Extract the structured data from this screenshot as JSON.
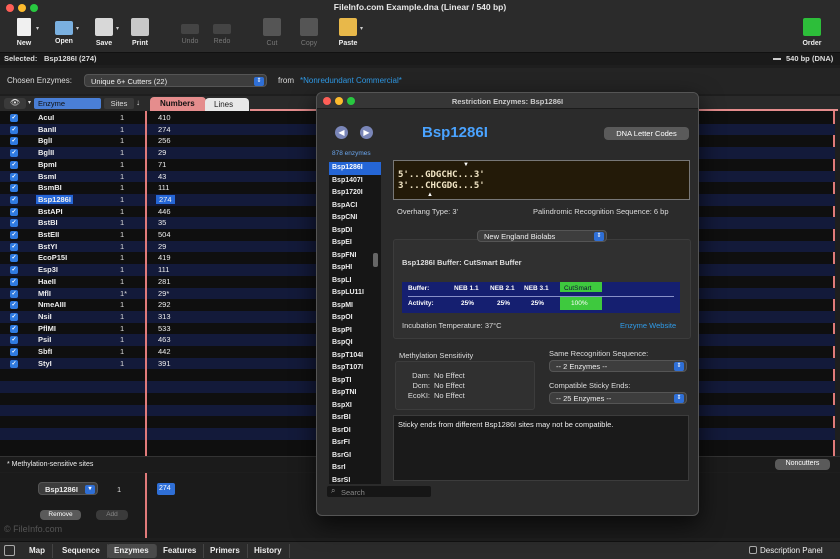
{
  "window": {
    "title": "FileInfo.com Example.dna  (Linear / 540 bp)"
  },
  "toolbar": {
    "new": "New",
    "open": "Open",
    "save": "Save",
    "print": "Print",
    "undo": "Undo",
    "redo": "Redo",
    "cut": "Cut",
    "copy": "Copy",
    "paste": "Paste",
    "order": "Order"
  },
  "selection": {
    "label": "Selected:",
    "value": "Bsp1286I (274)",
    "length": "540 bp",
    "type": "(DNA)"
  },
  "chosen": {
    "label": "Chosen Enzymes:",
    "value": "Unique 6+ Cutters  (22)",
    "from_label": "from",
    "from_value": "*Nonredundant Commercial*"
  },
  "columns": {
    "enzyme": "Enzyme",
    "sites": "Sites",
    "numbers": "Numbers",
    "lines": "Lines"
  },
  "enzymes": [
    {
      "name": "AcuI",
      "sites": "1",
      "number": "410"
    },
    {
      "name": "BanII",
      "sites": "1",
      "number": "274"
    },
    {
      "name": "BglI",
      "sites": "1",
      "number": "256"
    },
    {
      "name": "BglII",
      "sites": "1",
      "number": "29"
    },
    {
      "name": "BpmI",
      "sites": "1",
      "number": "71"
    },
    {
      "name": "BsmI",
      "sites": "1",
      "number": "43"
    },
    {
      "name": "BsmBI",
      "sites": "1",
      "number": "111"
    },
    {
      "name": "Bsp1286I",
      "sites": "1",
      "number": "274"
    },
    {
      "name": "BstAPI",
      "sites": "1",
      "number": "446"
    },
    {
      "name": "BstBI",
      "sites": "1",
      "number": "35"
    },
    {
      "name": "BstEII",
      "sites": "1",
      "number": "504"
    },
    {
      "name": "BstYI",
      "sites": "1",
      "number": "29"
    },
    {
      "name": "EcoP15I",
      "sites": "1",
      "number": "419"
    },
    {
      "name": "Esp3I",
      "sites": "1",
      "number": "111"
    },
    {
      "name": "HaeII",
      "sites": "1",
      "number": "281"
    },
    {
      "name": "MflI",
      "sites": "1*",
      "number": "29*"
    },
    {
      "name": "NmeAIII",
      "sites": "1",
      "number": "292"
    },
    {
      "name": "NsiI",
      "sites": "1",
      "number": "313"
    },
    {
      "name": "PflMI",
      "sites": "1",
      "number": "533"
    },
    {
      "name": "PsiI",
      "sites": "1",
      "number": "463"
    },
    {
      "name": "SbfI",
      "sites": "1",
      "number": "442"
    },
    {
      "name": "StyI",
      "sites": "1",
      "number": "391"
    }
  ],
  "footer": {
    "note": "* Methylation-sensitive sites",
    "noncutters": "Noncutters",
    "editor_enzyme": "Bsp1286I",
    "editor_sites": "1",
    "editor_number": "274",
    "remove": "Remove",
    "add": "Add",
    "watermark": "© FileInfo.com"
  },
  "tabs": [
    "Map",
    "Sequence",
    "Enzymes",
    "Features",
    "Primers",
    "History"
  ],
  "description_panel": "Description Panel",
  "dialog": {
    "title": "Restriction Enzymes: Bsp1286I",
    "count": "878 enzymes",
    "enzyme_name": "Bsp1286I",
    "dna_codes_btn": "DNA Letter Codes",
    "seq_top": "5'...GDGCHC...3'",
    "seq_bottom": "3'...CHCGDG...5'",
    "overhang": "Overhang Type:  3'",
    "palindromic": "Palindromic Recognition Sequence:  6 bp",
    "supplier": "New England Biolabs",
    "buffer": "Bsp1286I Buffer:  CutSmart Buffer",
    "buffer_header": [
      "Buffer:",
      "NEB 1.1",
      "NEB 2.1",
      "NEB 3.1",
      "CutSmart"
    ],
    "buffer_activity": [
      "Activity:",
      "25%",
      "25%",
      "25%",
      "100%"
    ],
    "incubation": "Incubation Temperature:  37°C",
    "website": "Enzyme Website",
    "methylation_title": "Methylation Sensitivity",
    "methylation": [
      {
        "k": "Dam:",
        "v": "No Effect"
      },
      {
        "k": "Dcm:",
        "v": "No Effect"
      },
      {
        "k": "EcoKI:",
        "v": "No Effect"
      }
    ],
    "same_recognition_label": "Same Recognition Sequence:",
    "same_recognition_value": "-- 2 Enzymes --",
    "sticky_label": "Compatible Sticky Ends:",
    "sticky_value": "-- 25 Enzymes --",
    "note": "Sticky ends from different Bsp1286I sites may not be compatible.",
    "search_placeholder": "Search",
    "list": [
      "Bsp1286I",
      "Bsp1407I",
      "Bsp1720I",
      "BspACI",
      "BspCNI",
      "BspDI",
      "BspEI",
      "BspFNI",
      "BspHI",
      "BspLI",
      "BspLU11I",
      "BspMI",
      "BspOI",
      "BspPI",
      "BspQI",
      "BspT104I",
      "BspT107I",
      "BspTI",
      "BspTNI",
      "BspXI",
      "BsrBI",
      "BsrDI",
      "BsrFI",
      "BsrGI",
      "BsrI",
      "BsrSI"
    ]
  },
  "colors": {
    "accent": "#2f7ae0",
    "cutsmart": "#3ec93e",
    "link": "#2f9be8",
    "table_stripe": "#131a3a"
  }
}
